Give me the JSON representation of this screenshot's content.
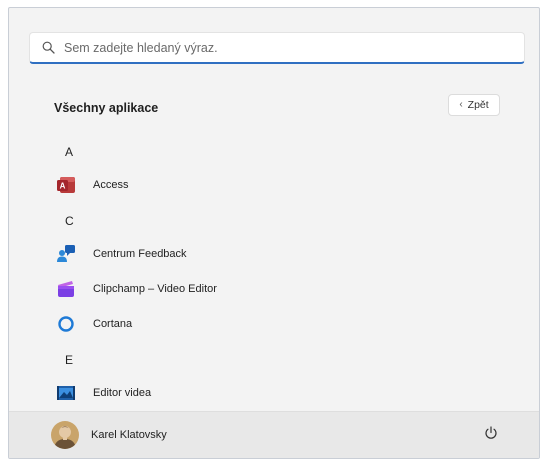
{
  "search": {
    "placeholder": "Sem zadejte hledaný výraz.",
    "icon": "search-icon"
  },
  "all_apps": {
    "title": "Všechny aplikace",
    "back_label": "Zpět"
  },
  "app_list": {
    "letters": [
      "A",
      "C",
      "E"
    ],
    "apps": [
      {
        "label": "Access",
        "icon": "access-icon"
      },
      {
        "label": "Centrum Feedback",
        "icon": "feedback-hub-icon"
      },
      {
        "label": "Clipchamp – Video Editor",
        "icon": "clipchamp-icon"
      },
      {
        "label": "Cortana",
        "icon": "cortana-icon"
      },
      {
        "label": "Editor videa",
        "icon": "video-editor-icon"
      }
    ]
  },
  "footer": {
    "user_name": "Karel Klatovsky",
    "power_icon": "power-icon"
  },
  "colors": {
    "accent": "#2f6fc1",
    "panel_bg": "#f3f3f3",
    "footer_bg": "#e8e8e8"
  }
}
